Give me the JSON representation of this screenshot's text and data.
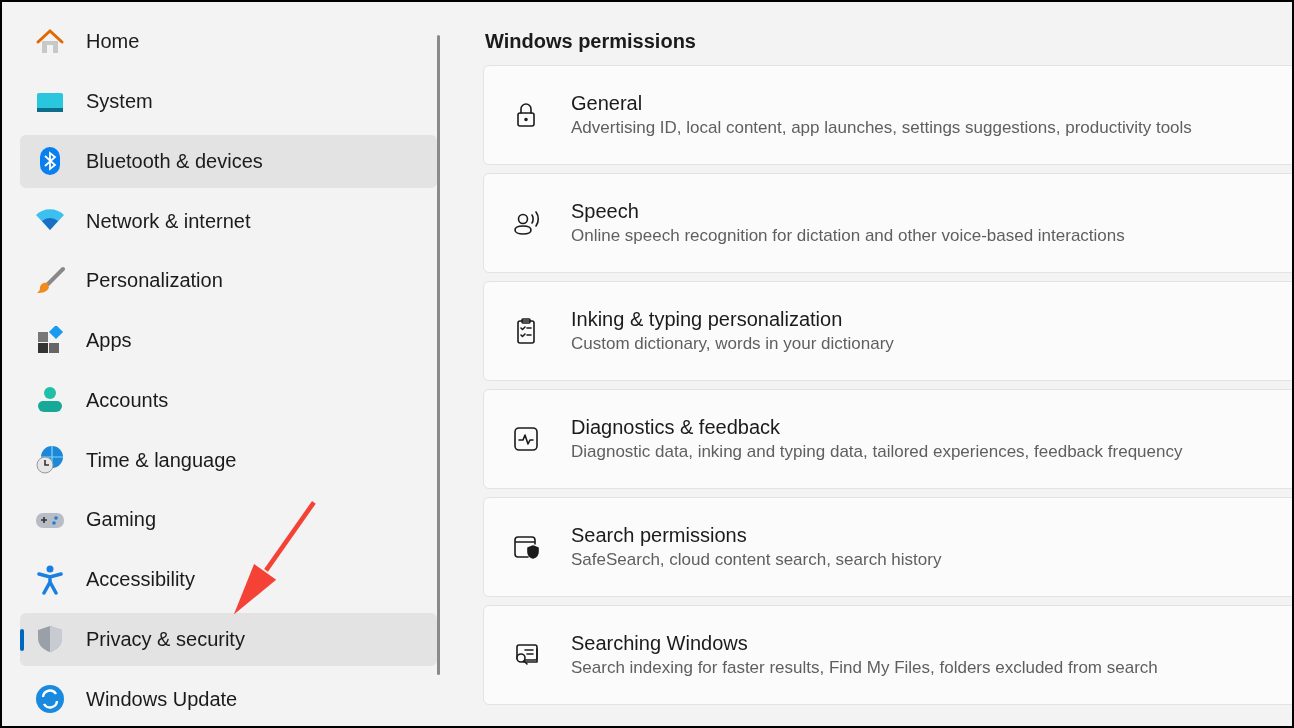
{
  "sidebar": {
    "items": [
      {
        "label": "Home",
        "selected": false,
        "hovered": false
      },
      {
        "label": "System",
        "selected": false,
        "hovered": false
      },
      {
        "label": "Bluetooth & devices",
        "selected": false,
        "hovered": true
      },
      {
        "label": "Network & internet",
        "selected": false,
        "hovered": false
      },
      {
        "label": "Personalization",
        "selected": false,
        "hovered": false
      },
      {
        "label": "Apps",
        "selected": false,
        "hovered": false
      },
      {
        "label": "Accounts",
        "selected": false,
        "hovered": false
      },
      {
        "label": "Time & language",
        "selected": false,
        "hovered": false
      },
      {
        "label": "Gaming",
        "selected": false,
        "hovered": false
      },
      {
        "label": "Accessibility",
        "selected": false,
        "hovered": false
      },
      {
        "label": "Privacy & security",
        "selected": true,
        "hovered": false
      },
      {
        "label": "Windows Update",
        "selected": false,
        "hovered": false
      }
    ]
  },
  "section": {
    "title": "Windows permissions",
    "cards": [
      {
        "title": "General",
        "subtitle": "Advertising ID, local content, app launches, settings suggestions, productivity tools"
      },
      {
        "title": "Speech",
        "subtitle": "Online speech recognition for dictation and other voice-based interactions"
      },
      {
        "title": "Inking & typing personalization",
        "subtitle": "Custom dictionary, words in your dictionary"
      },
      {
        "title": "Diagnostics & feedback",
        "subtitle": "Diagnostic data, inking and typing data, tailored experiences, feedback frequency"
      },
      {
        "title": "Search permissions",
        "subtitle": "SafeSearch, cloud content search, search history"
      },
      {
        "title": "Searching Windows",
        "subtitle": "Search indexing for faster results, Find My Files, folders excluded from search"
      }
    ]
  }
}
